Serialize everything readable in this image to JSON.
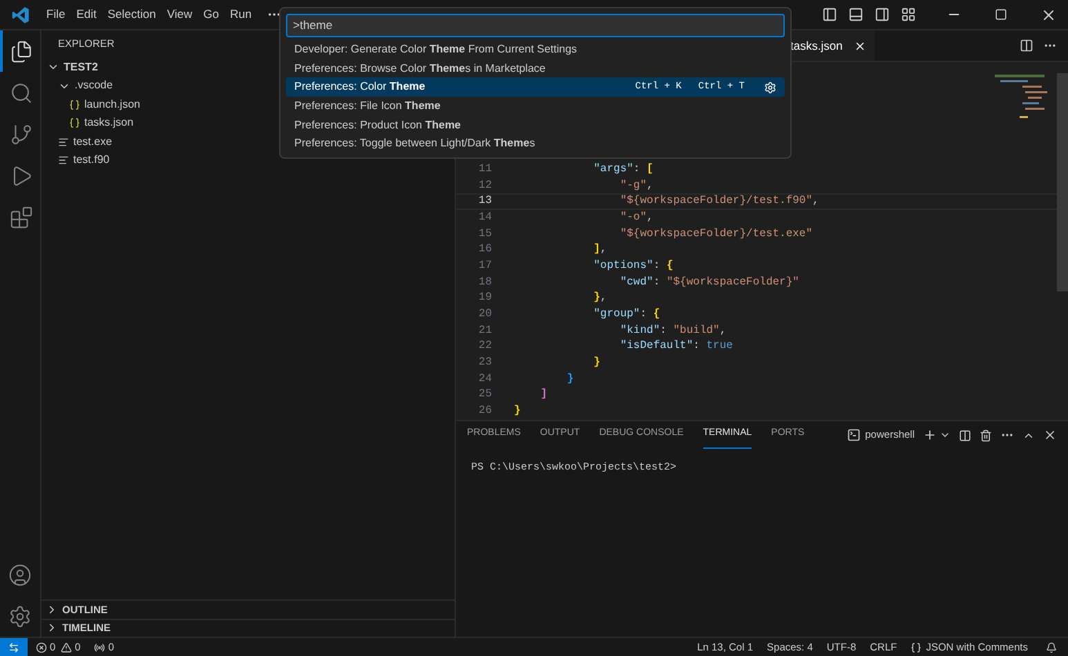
{
  "title_bar": {
    "menus": [
      "File",
      "Edit",
      "Selection",
      "View",
      "Go",
      "Run"
    ]
  },
  "activity_bar": [
    {
      "selected": true
    },
    {
      "selected": false
    },
    {
      "selected": false
    },
    {
      "selected": false
    },
    {
      "selected": false
    }
  ],
  "sidebar": {
    "title": "EXPLORER",
    "tree": [
      {
        "label": "TEST2",
        "expanded": true,
        "children": [
          {
            "label": ".vscode",
            "expanded": true,
            "children": [
              {
                "label": "launch.json",
                "kind": "json"
              },
              {
                "label": "tasks.json",
                "kind": "json"
              }
            ]
          },
          {
            "label": "test.exe",
            "kind": "file"
          },
          {
            "label": "test.f90",
            "kind": "file"
          }
        ]
      }
    ],
    "sections": [
      {
        "label": "OUTLINE",
        "expanded": false
      },
      {
        "label": "TIMELINE",
        "expanded": false
      }
    ]
  },
  "editor": {
    "tabs": [
      {
        "label": "tasks.json",
        "selected": true
      }
    ],
    "lines": [
      {
        "number": "11",
        "current": false,
        "tokens": [
          {
            "kind": "key",
            "t": "            \"args\""
          },
          {
            "kind": "punct",
            "t": ": "
          },
          {
            "kind": "bracket",
            "t": "[",
            "color": "#ffd700"
          }
        ]
      },
      {
        "number": "12",
        "current": false,
        "tokens": [
          {
            "kind": "string",
            "t": "                \"-g\""
          },
          {
            "kind": "punct",
            "t": ","
          }
        ]
      },
      {
        "number": "13",
        "current": true,
        "tokens": [
          {
            "kind": "string",
            "t": "                \"${workspaceFolder}/test.f90\""
          },
          {
            "kind": "punct",
            "t": ","
          }
        ]
      },
      {
        "number": "14",
        "current": false,
        "tokens": [
          {
            "kind": "string",
            "t": "                \"-o\""
          },
          {
            "kind": "punct",
            "t": ","
          }
        ]
      },
      {
        "number": "15",
        "current": false,
        "tokens": [
          {
            "kind": "string",
            "t": "                \"${workspaceFolder}/test.exe\""
          }
        ]
      },
      {
        "number": "16",
        "current": false,
        "tokens": [
          {
            "kind": "bracket",
            "t": "            ]",
            "color": "#ffd700"
          },
          {
            "kind": "punct",
            "t": ","
          }
        ]
      },
      {
        "number": "17",
        "current": false,
        "tokens": [
          {
            "kind": "key",
            "t": "            \"options\""
          },
          {
            "kind": "punct",
            "t": ": "
          },
          {
            "kind": "bracket",
            "t": "{",
            "color": "#ffd700"
          }
        ]
      },
      {
        "number": "18",
        "current": false,
        "tokens": [
          {
            "kind": "key",
            "t": "                \"cwd\""
          },
          {
            "kind": "punct",
            "t": ": "
          },
          {
            "kind": "string",
            "t": "\"${workspaceFolder}\""
          }
        ]
      },
      {
        "number": "19",
        "current": false,
        "tokens": [
          {
            "kind": "bracket",
            "t": "            }",
            "color": "#ffd700"
          },
          {
            "kind": "punct",
            "t": ","
          }
        ]
      },
      {
        "number": "20",
        "current": false,
        "tokens": [
          {
            "kind": "key",
            "t": "            \"group\""
          },
          {
            "kind": "punct",
            "t": ": "
          },
          {
            "kind": "bracket",
            "t": "{",
            "color": "#ffd700"
          }
        ]
      },
      {
        "number": "21",
        "current": false,
        "tokens": [
          {
            "kind": "key",
            "t": "                \"kind\""
          },
          {
            "kind": "punct",
            "t": ": "
          },
          {
            "kind": "string",
            "t": "\"build\""
          },
          {
            "kind": "punct",
            "t": ","
          }
        ]
      },
      {
        "number": "22",
        "current": false,
        "tokens": [
          {
            "kind": "key",
            "t": "                \"isDefault\""
          },
          {
            "kind": "punct",
            "t": ": "
          },
          {
            "kind": "literal",
            "t": "true"
          }
        ]
      },
      {
        "number": "23",
        "current": false,
        "tokens": [
          {
            "kind": "bracket",
            "t": "            }",
            "color": "#ffd700"
          }
        ]
      },
      {
        "number": "24",
        "current": false,
        "tokens": [
          {
            "kind": "bracket",
            "t": "        }",
            "color": "#179fff"
          }
        ]
      },
      {
        "number": "25",
        "current": false,
        "tokens": [
          {
            "kind": "bracket",
            "t": "    ]",
            "color": "#da70d6"
          }
        ]
      },
      {
        "number": "26",
        "current": false,
        "tokens": [
          {
            "kind": "bracket",
            "t": "}",
            "color": "#ffd700"
          }
        ]
      }
    ]
  },
  "command_palette": {
    "value": ">theme",
    "items": [
      {
        "label": "Developer: Generate Color **Theme** From Current Settings",
        "selected": false
      },
      {
        "label": "Preferences: Browse Color **Theme**s in Marketplace",
        "selected": false
      },
      {
        "label": "Preferences: Color **Theme**",
        "selected": true,
        "keybindings": [
          "Ctrl + K",
          "Ctrl + T"
        ]
      },
      {
        "label": "Preferences: File Icon **Theme**",
        "selected": false
      },
      {
        "label": "Preferences: Product Icon **Theme**",
        "selected": false
      },
      {
        "label": "Preferences: Toggle between Light/Dark **Theme**s",
        "selected": false
      }
    ]
  },
  "panel": {
    "tabs": [
      {
        "label": "PROBLEMS",
        "selected": false
      },
      {
        "label": "OUTPUT",
        "selected": false
      },
      {
        "label": "DEBUG CONSOLE",
        "selected": false
      },
      {
        "label": "TERMINAL",
        "selected": true
      },
      {
        "label": "PORTS",
        "selected": false
      }
    ],
    "terminal_name": "powershell",
    "terminal_lines": [
      "PS C:\\Users\\swkoo\\Projects\\test2>"
    ]
  },
  "status_bar": {
    "errors": "0",
    "warnings": "0",
    "ports": "0",
    "items": [
      "Ln 13, Col 1",
      "Spaces: 4",
      "UTF-8",
      "CRLF"
    ],
    "language": "JSON with Comments"
  }
}
